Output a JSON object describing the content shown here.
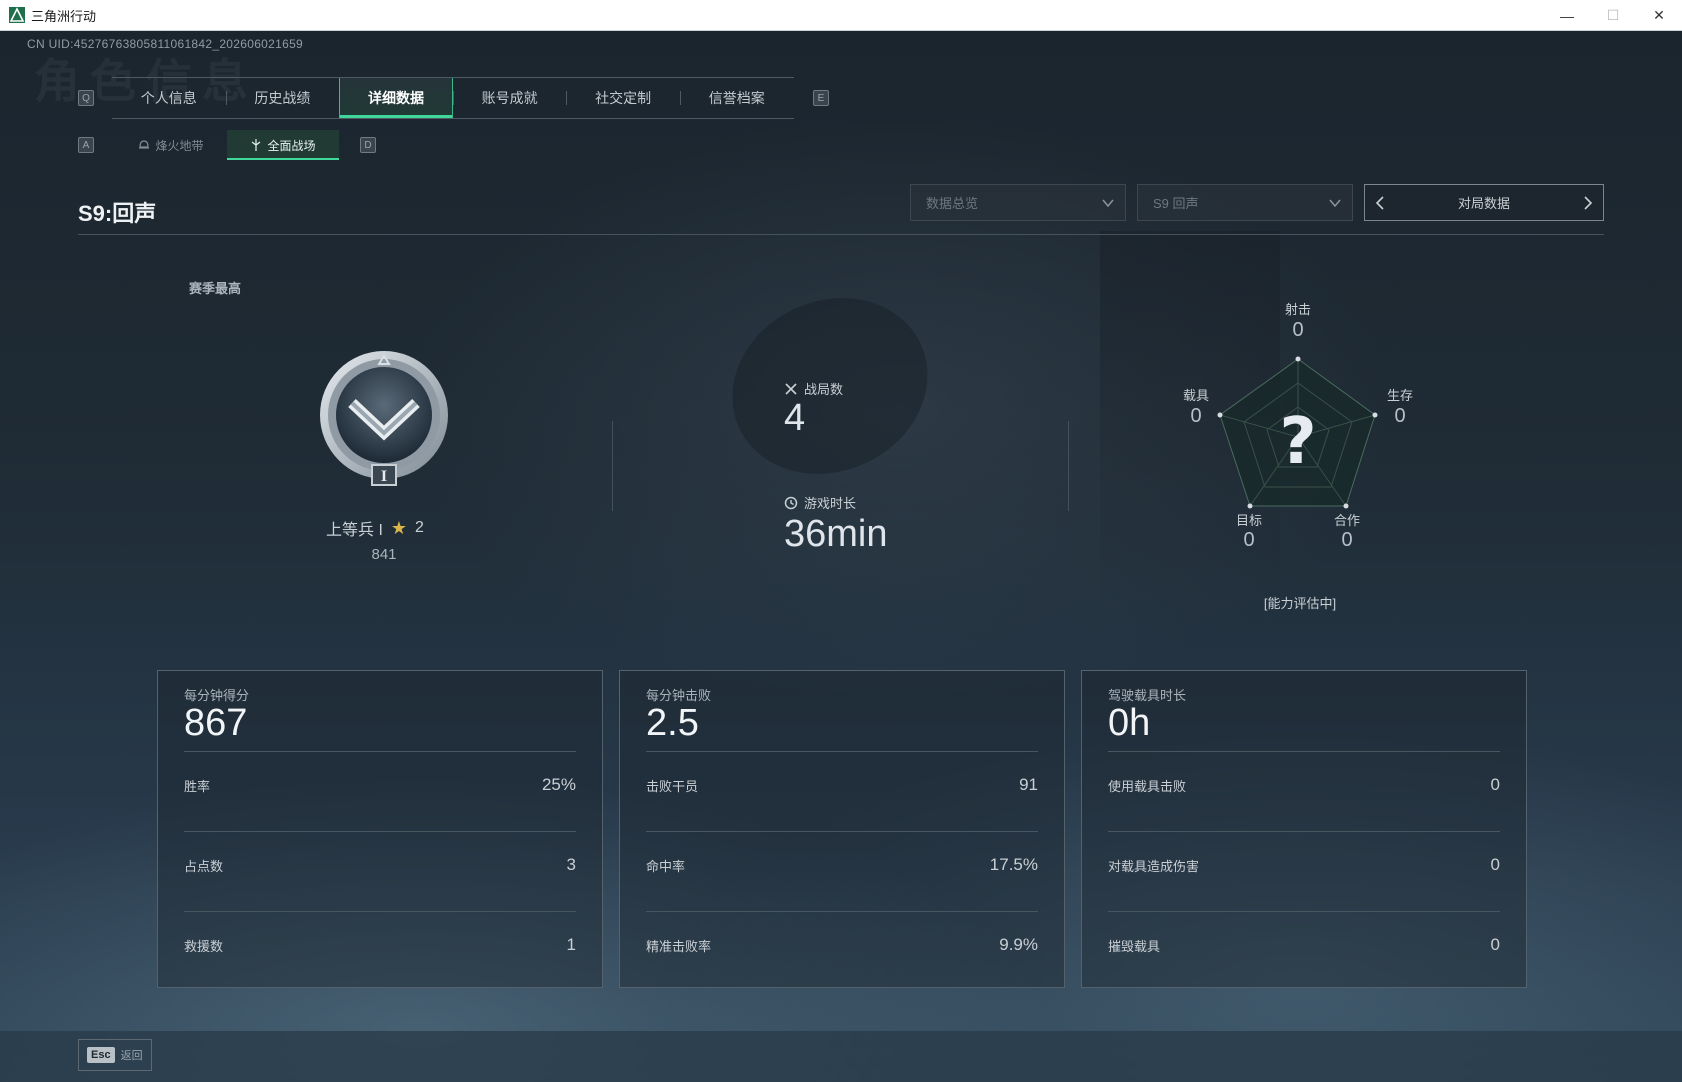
{
  "window": {
    "title": "三角洲行动",
    "minimize": "—",
    "maximize": "☐",
    "close": "✕"
  },
  "header": {
    "uid": "CN UID:4527676380581106184​2_202606021659",
    "bg_title": "角色信息"
  },
  "keys": {
    "prev_tab": "Q",
    "next_tab": "E",
    "prev_sub": "A",
    "next_sub": "D",
    "esc": "Esc"
  },
  "tabs": [
    {
      "label": "个人信息"
    },
    {
      "label": "历史战绩"
    },
    {
      "label": "详细数据",
      "active": true
    },
    {
      "label": "账号成就"
    },
    {
      "label": "社交定制"
    },
    {
      "label": "信誉档案"
    }
  ],
  "subtabs": [
    {
      "label": "烽火地带",
      "icon": "helmet-icon"
    },
    {
      "label": "全面战场",
      "icon": "crosshair-icon",
      "active": true
    }
  ],
  "season": {
    "title": "S9:回声",
    "dropdown_view": "数据总览",
    "dropdown_season": "S9 回声",
    "nav_label": "对局数据"
  },
  "season_best": {
    "label": "赛季最高",
    "rank_name": "上等兵 I",
    "stars": "2",
    "points": "841"
  },
  "match": {
    "matches_label": "战局数",
    "matches_value": "4",
    "time_label": "游戏时长",
    "time_value": "36min"
  },
  "radar": {
    "center_glyph": "?",
    "axes": [
      {
        "label": "射击",
        "value": "0"
      },
      {
        "label": "生存",
        "value": "0"
      },
      {
        "label": "合作",
        "value": "0"
      },
      {
        "label": "目标",
        "value": "0"
      },
      {
        "label": "载具",
        "value": "0"
      }
    ],
    "status": "[能力评估中]"
  },
  "cards": [
    {
      "title": "每分钟得分",
      "value": "867",
      "rows": [
        {
          "label": "胜率",
          "value": "25%"
        },
        {
          "label": "占点数",
          "value": "3"
        },
        {
          "label": "救援数",
          "value": "1"
        }
      ]
    },
    {
      "title": "每分钟击败",
      "value": "2.5",
      "rows": [
        {
          "label": "击败干员",
          "value": "91"
        },
        {
          "label": "命中率",
          "value": "17.5%"
        },
        {
          "label": "精准击败率",
          "value": "9.9%"
        }
      ]
    },
    {
      "title": "驾驶载具时长",
      "value": "0h",
      "rows": [
        {
          "label": "使用载具击败",
          "value": "0"
        },
        {
          "label": "对载具造成伤害",
          "value": "0"
        },
        {
          "label": "摧毁载具",
          "value": "0"
        }
      ]
    }
  ],
  "footer": {
    "back_label": "返回"
  },
  "colors": {
    "accent": "#3fd79a",
    "star": "#d9b64a"
  }
}
